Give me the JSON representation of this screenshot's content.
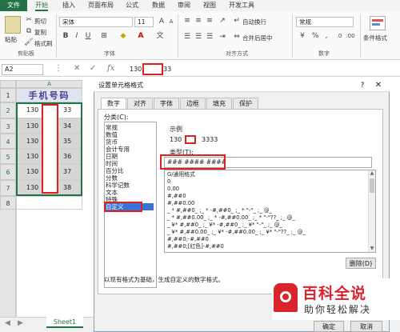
{
  "ribbon": {
    "tabs": [
      "文件",
      "开始",
      "插入",
      "页面布局",
      "公式",
      "数据",
      "审阅",
      "视图",
      "开发工具"
    ],
    "clipboard": {
      "cut": "剪切",
      "copy": "复制",
      "format_painter": "格式刷",
      "paste": "粘贴",
      "group": "剪贴板"
    },
    "font": {
      "name": "宋体",
      "size": "11",
      "group": "字体"
    },
    "alignment": {
      "wrap": "自动换行",
      "merge": "合并后居中",
      "group": "对齐方式"
    },
    "number": {
      "format": "常规",
      "group": "数字"
    },
    "styles": {
      "conditional": "条件格式"
    }
  },
  "formula_bar": {
    "name_box": "A2",
    "content_prefix": "130",
    "content_suffix": "33"
  },
  "sheet": {
    "column": "A",
    "rows": [
      "1",
      "2",
      "3",
      "4",
      "5",
      "6",
      "7",
      "8"
    ],
    "header": "手机号码",
    "cells": [
      {
        "prefix": "130",
        "suffix": "33"
      },
      {
        "prefix": "130",
        "suffix": "34"
      },
      {
        "prefix": "130",
        "suffix": "35"
      },
      {
        "prefix": "130",
        "suffix": "36"
      },
      {
        "prefix": "130",
        "suffix": "37"
      },
      {
        "prefix": "130",
        "suffix": "38"
      }
    ],
    "tab": "Sheet1"
  },
  "dialog": {
    "title": "设置单元格格式",
    "help": "?",
    "close": "✕",
    "tabs": [
      "数字",
      "对齐",
      "字体",
      "边框",
      "填充",
      "保护"
    ],
    "category_label": "分类(C):",
    "categories": [
      "常规",
      "数值",
      "货币",
      "会计专用",
      "日期",
      "时间",
      "百分比",
      "分数",
      "科学记数",
      "文本",
      "特殊",
      "自定义"
    ],
    "selected_category": "自定义",
    "sample_label": "示例",
    "sample_prefix": "130",
    "sample_suffix": "3333",
    "type_label": "类型(T):",
    "type_value": "### #### ####",
    "formats": [
      "G/通用格式",
      "0",
      "0.00",
      "#,##0",
      "#,##0.00",
      "_ * #,##0_ ;_ * -#,##0_ ;_ * \"-\"_ ;_ @_",
      "_ * #,##0.00_ ;_ * -#,##0.00_ ;_ * \"-\"??_ ;_ @_",
      "_ ¥* #,##0_ ;_ ¥* -#,##0_ ;_ ¥* \"-\"_ ;_ @_",
      "_ ¥* #,##0.00_ ;_ ¥* -#,##0.00_ ;_ ¥* \"-\"??_ ;_ @_",
      "#,##0;-#,##0",
      "#,##0;[红色]-#,##0"
    ],
    "delete_button": "删除(D)",
    "description": "以现有格式为基础，生成自定义的数字格式。",
    "ok_button": "确定",
    "cancel_button": "取消"
  },
  "watermark": {
    "line1": "百科全说",
    "line2": "助你轻松解决"
  },
  "colors": {
    "excel_green": "#217346",
    "highlight_red": "#e02020",
    "selection_blue": "#3b74d8"
  }
}
